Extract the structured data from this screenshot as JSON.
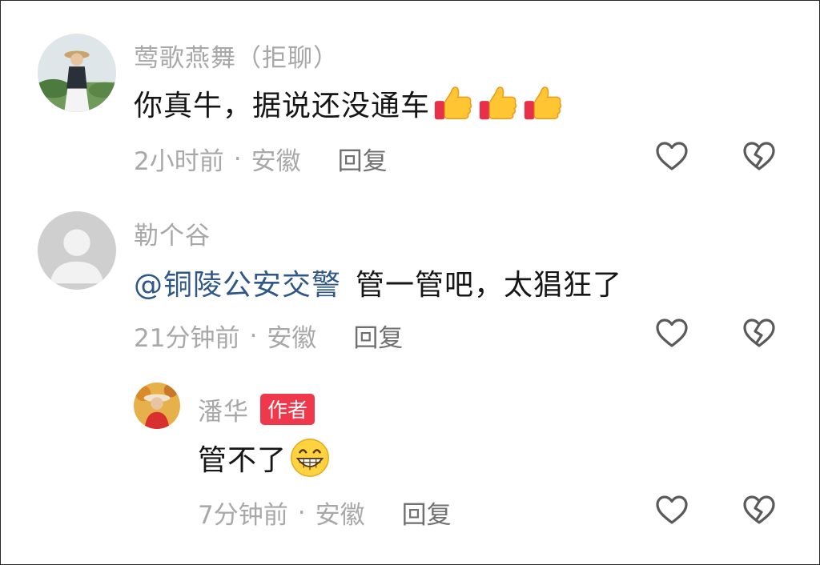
{
  "comments": [
    {
      "author": "莺歌燕舞（拒聊）",
      "text": "你真牛，据说还没通车",
      "emojis": [
        "thumbs-up",
        "thumbs-up",
        "thumbs-up"
      ],
      "time": "2小时前",
      "location": "安徽",
      "reply_label": "回复"
    },
    {
      "author": "勒个谷",
      "mention": "@铜陵公安交警",
      "text": "管一管吧，太猖狂了",
      "time": "21分钟前",
      "location": "安徽",
      "reply_label": "回复"
    }
  ],
  "reply": {
    "author": "潘华",
    "badge": "作者",
    "text": "管不了",
    "emoji": "grinning-face",
    "time": "7分钟前",
    "location": "安徽",
    "reply_label": "回复"
  },
  "separator": "·",
  "icons": {
    "like": "heart-outline-icon",
    "dislike": "broken-heart-outline-icon"
  },
  "colors": {
    "badge": "#f0384d",
    "mention": "#2f5787",
    "secondary_text": "#a8a8a8"
  }
}
